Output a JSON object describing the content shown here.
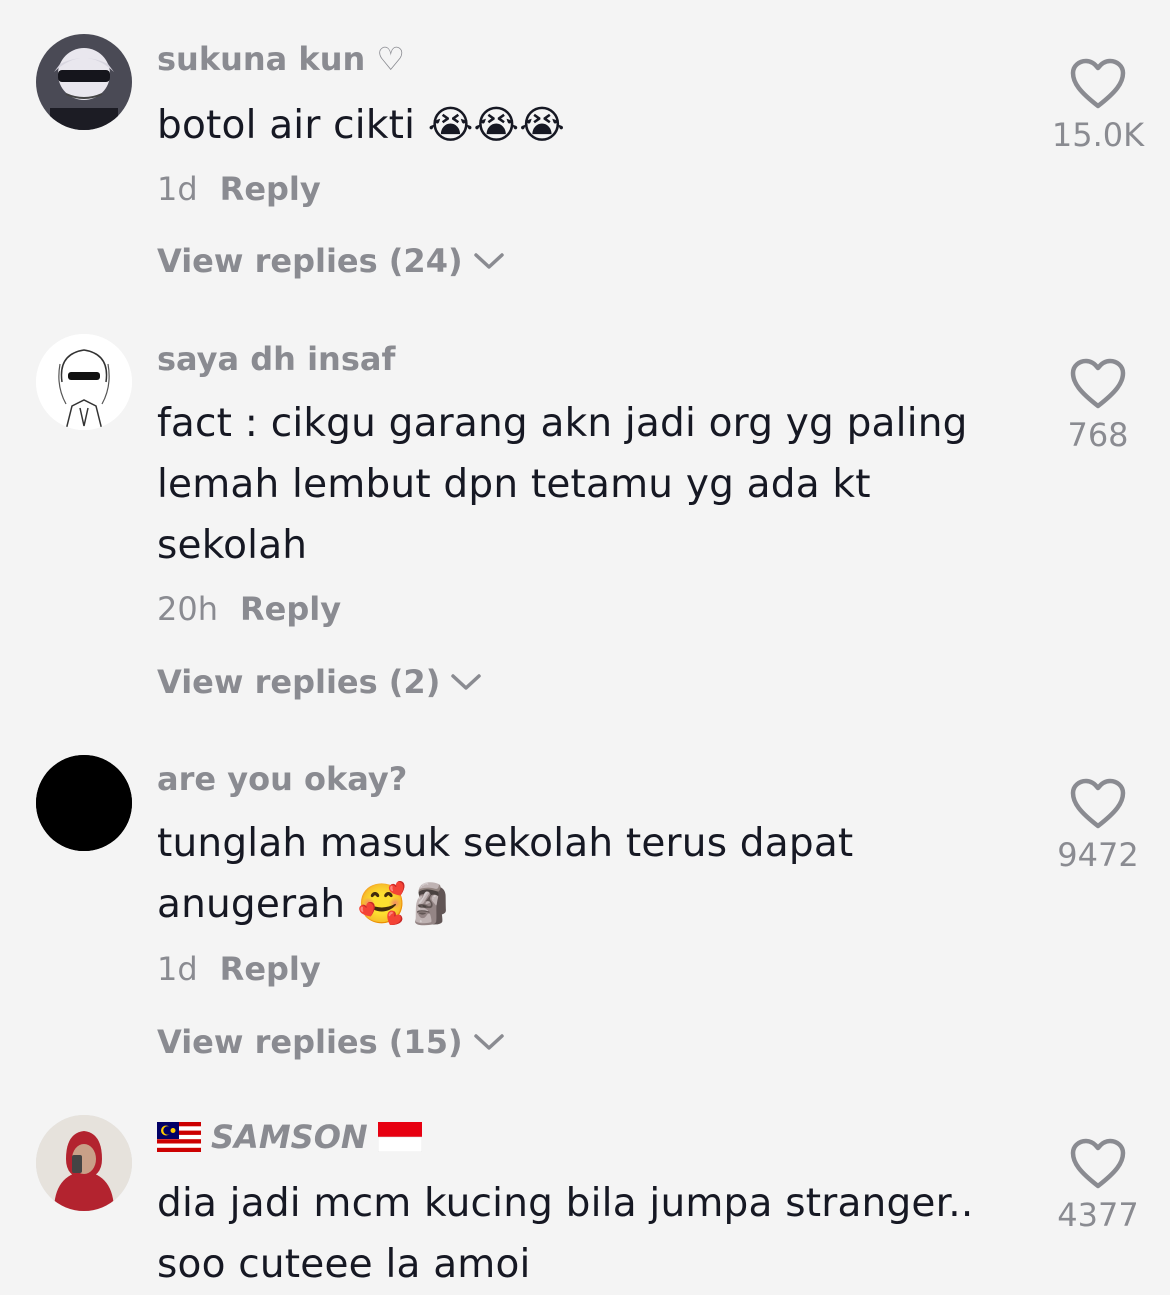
{
  "comments": [
    {
      "username": "sukuna kun ♡",
      "text": "botol air cikti 😭😭😭",
      "time": "1d",
      "reply_label": "Reply",
      "view_replies": "View replies (24)",
      "likes": "15.0K",
      "avatar": "anime-character-avatar"
    },
    {
      "username": "saya dh insaf",
      "text": "fact : cikgu garang akn jadi org yg paling lemah lembut dpn tetamu yg ada kt sekolah",
      "time": "20h",
      "reply_label": "Reply",
      "view_replies": "View replies (2)",
      "likes": "768",
      "avatar": "sketch-character-avatar"
    },
    {
      "username": "are you okay?",
      "text": "tunglah masuk sekolah terus dapat anugerah 🥰🗿",
      "time": "1d",
      "reply_label": "Reply",
      "view_replies": "View replies (15)",
      "likes": "9472",
      "avatar": "black-circle-avatar"
    },
    {
      "username": "SAMSON",
      "username_prefix_flag": "malaysia-flag",
      "username_suffix_flag": "indonesia-flag",
      "text": "dia jadi mcm kucing bila jumpa stranger.. soo cuteee la amoi",
      "likes": "4377",
      "avatar": "person-red-hoodie-avatar"
    }
  ],
  "colors": {
    "background": "#f4f4f4",
    "primary_text": "#161823",
    "secondary_text": "#8a8b91"
  }
}
